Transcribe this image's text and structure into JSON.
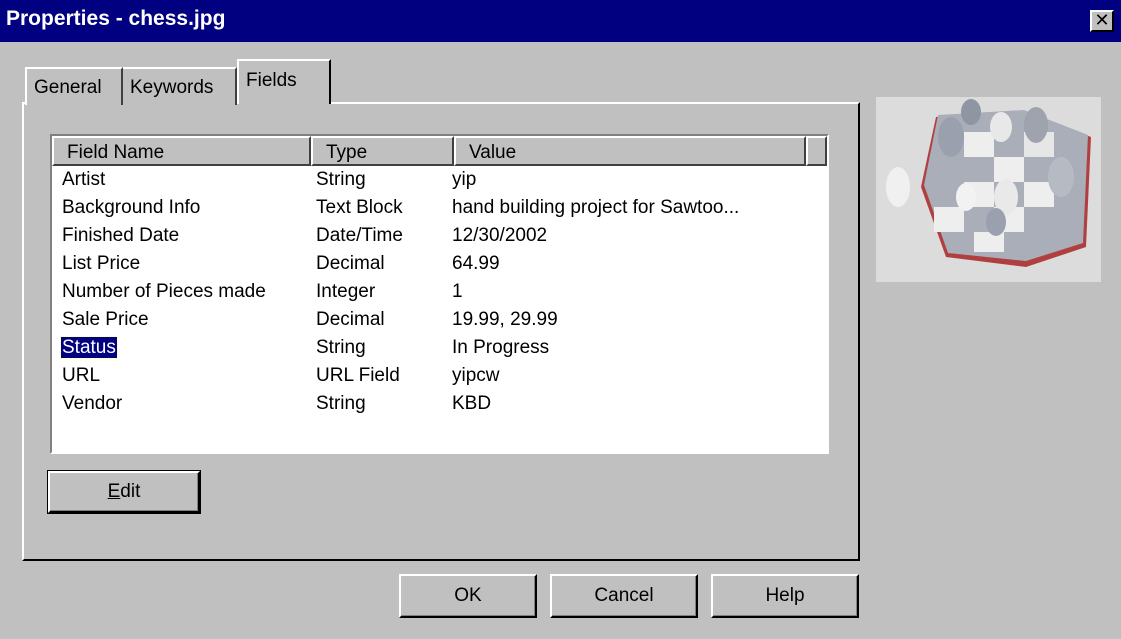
{
  "window": {
    "title": "Properties - chess.jpg",
    "close_glyph": "✕"
  },
  "tabs": [
    {
      "label": "General",
      "active": false
    },
    {
      "label": "Keywords",
      "active": false
    },
    {
      "label": "Fields",
      "active": true
    }
  ],
  "fields_table": {
    "columns": [
      "Field Name",
      "Type",
      "Value"
    ],
    "rows": [
      {
        "name": "Artist",
        "type": "String",
        "value": "yip"
      },
      {
        "name": "Background Info",
        "type": "Text Block",
        "value": "hand building project for Sawtoo..."
      },
      {
        "name": "Finished Date",
        "type": "Date/Time",
        "value": "12/30/2002"
      },
      {
        "name": "List Price",
        "type": "Decimal",
        "value": "64.99"
      },
      {
        "name": "Number of Pieces made",
        "type": "Integer",
        "value": "1"
      },
      {
        "name": "Sale Price",
        "type": "Decimal",
        "value": "19.99, 29.99"
      },
      {
        "name": "Status",
        "type": "String",
        "value": "In Progress",
        "selected": true
      },
      {
        "name": "URL",
        "type": "URL Field",
        "value": "yipcw"
      },
      {
        "name": "Vendor",
        "type": "String",
        "value": "KBD"
      }
    ]
  },
  "buttons": {
    "edit_mnemonic": "E",
    "edit_rest": "dit",
    "ok": "OK",
    "cancel": "Cancel",
    "help": "Help"
  },
  "colors": {
    "titlebar": "#000080",
    "face": "#c0c0c0",
    "selection": "#000080"
  }
}
